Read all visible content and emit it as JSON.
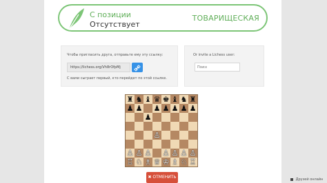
{
  "header": {
    "variant_line": "С позиции",
    "time_line": "Отсутствует",
    "mode": "ТОВАРИЩЕСКАЯ"
  },
  "invite": {
    "hint": "Чтобы пригласить друга, отправьте ему эту ссылку:",
    "link": "https://lichess.org/Vh8rOfpMj",
    "note": "С вами сыграет первый, кто перейдет по этой ссылке."
  },
  "invite_user": {
    "label": "Or invite a Lichess user:",
    "placeholder": "Поиск"
  },
  "board": {
    "rows": [
      [
        "♜",
        "♞",
        "♝",
        "♛",
        "♚",
        "♝",
        "♞",
        "♜"
      ],
      [
        "♟",
        "♟",
        "",
        "♟",
        "♟",
        "♟",
        "♟",
        "♟"
      ],
      [
        "",
        "",
        "♟",
        "",
        "",
        "",
        "",
        ""
      ],
      [
        "",
        "",
        "",
        "",
        "",
        "",
        "",
        ""
      ],
      [
        "",
        "",
        "",
        "♙",
        "",
        "",
        "",
        ""
      ],
      [
        "",
        "",
        "",
        "",
        "",
        "",
        "",
        ""
      ],
      [
        "♙",
        "♙",
        "♙",
        "",
        "♙",
        "♙",
        "♙",
        "♙"
      ],
      [
        "♖",
        "♘",
        "♗",
        "♕",
        "♔",
        "♗",
        "♘",
        "♖"
      ]
    ],
    "flipped": true
  },
  "cancel_label": "ОТМЕНИТЬ",
  "online_label": "Друзей онлайн"
}
